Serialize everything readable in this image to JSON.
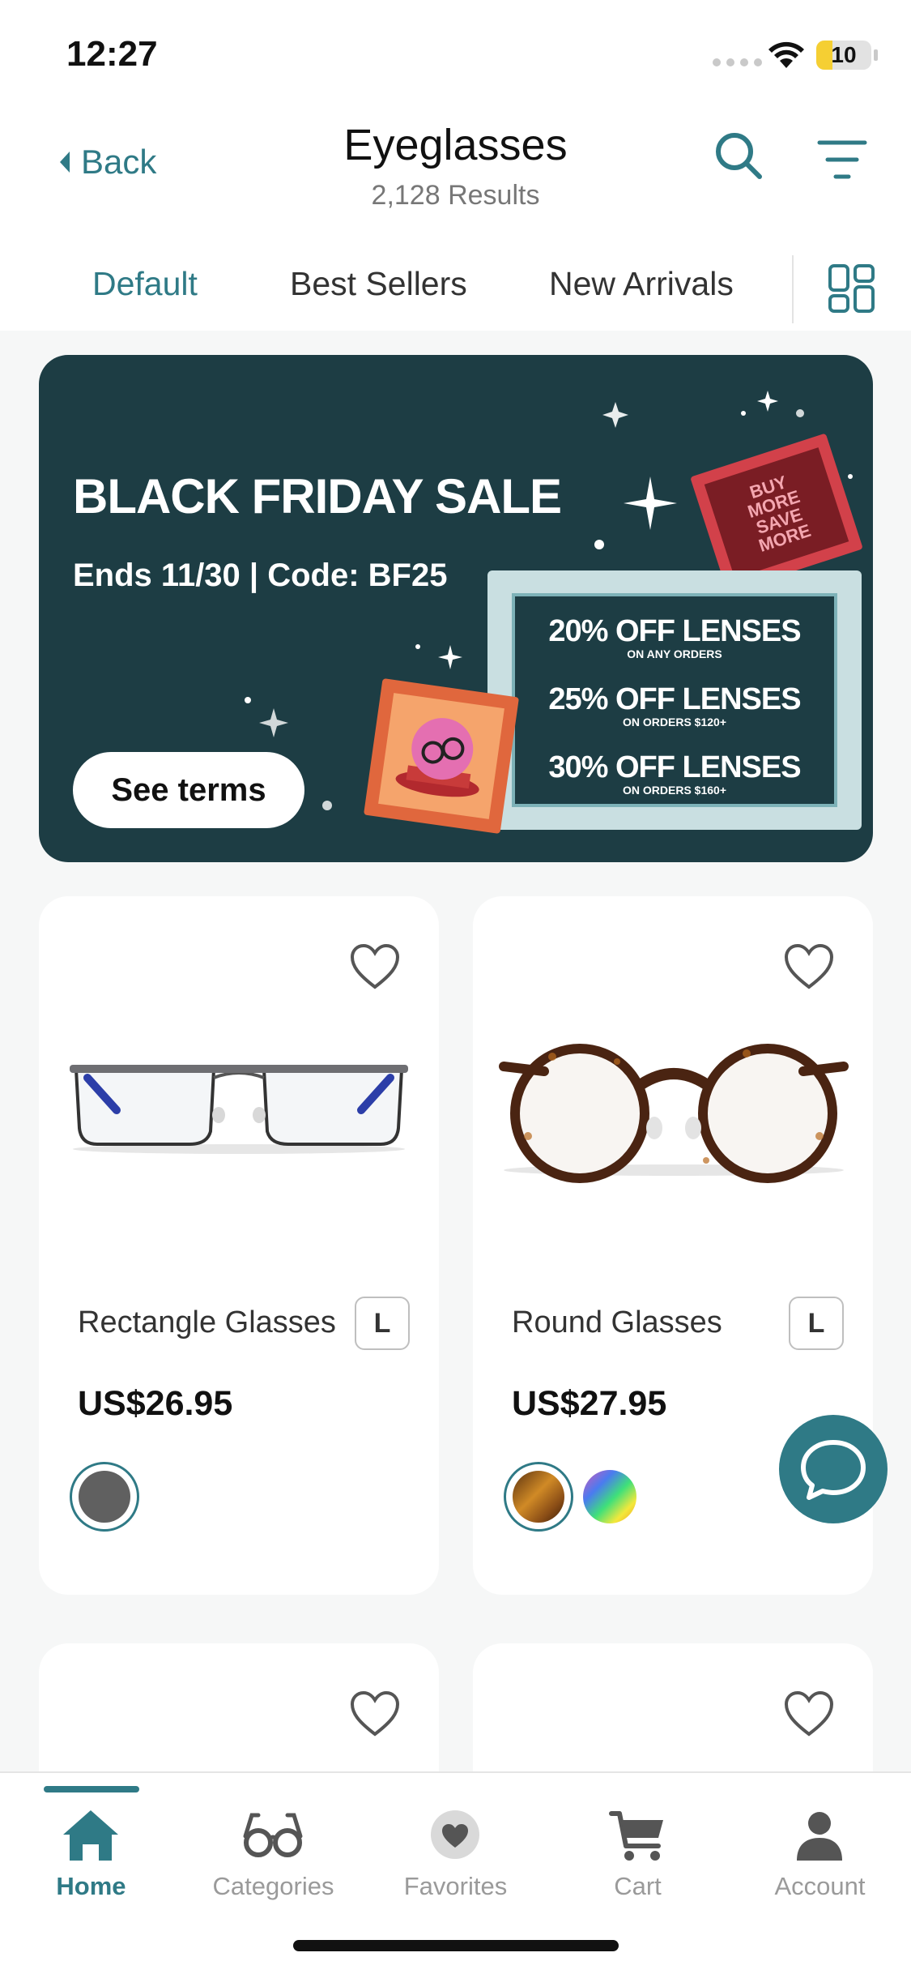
{
  "status_bar": {
    "time": "12:27",
    "battery": "10"
  },
  "header": {
    "back_label": "Back",
    "title": "Eyeglasses",
    "results": "2,128 Results",
    "icons": [
      "search-icon",
      "filter-icon"
    ]
  },
  "tabs": [
    {
      "label": "Default",
      "active": true
    },
    {
      "label": "Best Sellers",
      "active": false
    },
    {
      "label": "New Arrivals",
      "active": false
    }
  ],
  "banner": {
    "title": "BLACK FRIDAY SALE",
    "subtitle": "Ends 11/30 | Code: BF25",
    "button": "See terms",
    "stamp_text": [
      "BUY",
      "MORE",
      "SAVE",
      "MORE"
    ],
    "offers": [
      {
        "headline": "20% OFF LENSES",
        "condition": "ON ANY ORDERS"
      },
      {
        "headline": "25% OFF LENSES",
        "condition": "ON ORDERS $120+"
      },
      {
        "headline": "30% OFF LENSES",
        "condition": "ON ORDERS $160+"
      }
    ]
  },
  "products": [
    {
      "name": "Rectangle Glasses",
      "size": "L",
      "price": "US$26.95",
      "colors": [
        "#606060"
      ]
    },
    {
      "name": "Round Glasses",
      "size": "L",
      "price": "US$27.95",
      "colors": [
        "#c98a2a",
        "rainbow"
      ]
    }
  ],
  "bottom_nav": [
    {
      "label": "Home",
      "icon": "home-icon",
      "active": true
    },
    {
      "label": "Categories",
      "icon": "glasses-icon",
      "active": false
    },
    {
      "label": "Favorites",
      "icon": "heart-icon",
      "active": false
    },
    {
      "label": "Cart",
      "icon": "cart-icon",
      "active": false
    },
    {
      "label": "Account",
      "icon": "account-icon",
      "active": false
    }
  ],
  "colors": {
    "accent": "#2f7a86",
    "banner_bg": "#1d3d44"
  }
}
